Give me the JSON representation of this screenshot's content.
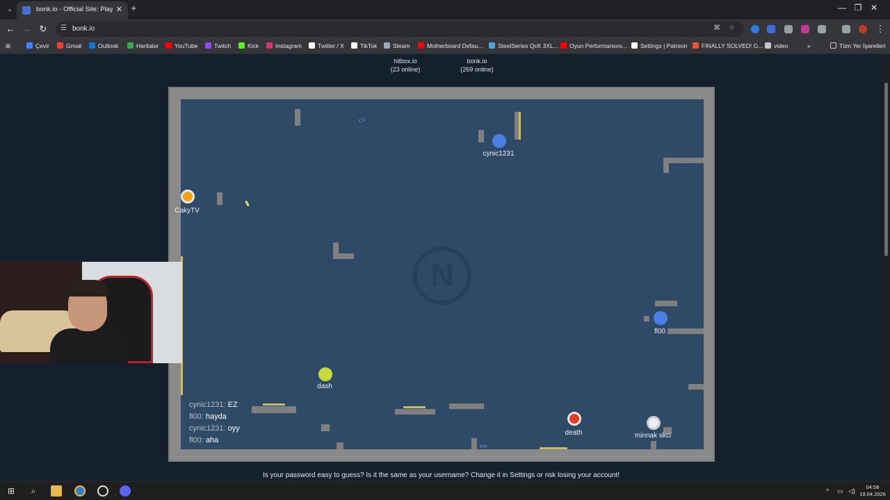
{
  "browser": {
    "tab_title": "bonk.io - Official Site: Play Bonk",
    "url": "bonk.io",
    "new_tab_symbol": "+",
    "tab_close_symbol": "✕",
    "window_controls": [
      "—",
      "❐",
      "✕"
    ],
    "bookmarks": [
      {
        "label": "Çevir",
        "color": "#4285f4"
      },
      {
        "label": "Gmail",
        "color": "#ea4335"
      },
      {
        "label": "Outlook",
        "color": "#0f78d4"
      },
      {
        "label": "Haritalar",
        "color": "#34a853"
      },
      {
        "label": "YouTube",
        "color": "#ff0000"
      },
      {
        "label": "Twitch",
        "color": "#9146ff"
      },
      {
        "label": "Kick",
        "color": "#53fc18"
      },
      {
        "label": "Instagram",
        "color": "#e1306c"
      },
      {
        "label": "Twitter / X",
        "color": "#ffffff"
      },
      {
        "label": "TikTok",
        "color": "#ffffff"
      },
      {
        "label": "Steam",
        "color": "#9ab"
      },
      {
        "label": "Motherboard Defau...",
        "color": "#ff0000"
      },
      {
        "label": "SteelSeries QcK 3XL...",
        "color": "#4fa3e0"
      },
      {
        "label": "Oyun Performansını...",
        "color": "#ff0000"
      },
      {
        "label": "Settings | Patreon",
        "color": "#ffffff"
      },
      {
        "label": "FINALLY SOLVED! G...",
        "color": "#e8533a"
      },
      {
        "label": "video",
        "color": "#c4c7c5"
      }
    ],
    "bookmarks_overflow": "»",
    "all_bookmarks_label": "Tüm Yer İşaretleri"
  },
  "game": {
    "servers": [
      {
        "name": "hitbox.io",
        "online": "(23 online)"
      },
      {
        "name": "bonk.io",
        "online": "(269 online)"
      }
    ],
    "logo_letter": "N",
    "players": [
      {
        "name": "cynic1231",
        "color": "#4a7fe6"
      },
      {
        "name": "CakyTV",
        "color": "#f2a30f"
      },
      {
        "name": "fl00",
        "color": "#4a7fe6"
      },
      {
        "name": "dash",
        "color": "#c8d93a"
      },
      {
        "name": "death",
        "color": "#e23d25"
      },
      {
        "name": "minnak skci",
        "color": "#eeeeee"
      }
    ],
    "chat": [
      {
        "name": "cynic1231",
        "msg": "EZ"
      },
      {
        "name": "fl00",
        "msg": "hayda"
      },
      {
        "name": "cynic1231",
        "msg": "oyy"
      },
      {
        "name": "fl00",
        "msg": "aha"
      }
    ],
    "notice": "Is your password easy to guess? Is it the same as your username? Change it in Settings or risk losing your account!"
  },
  "taskbar": {
    "time": "04:58",
    "date": "19.04.2026"
  }
}
